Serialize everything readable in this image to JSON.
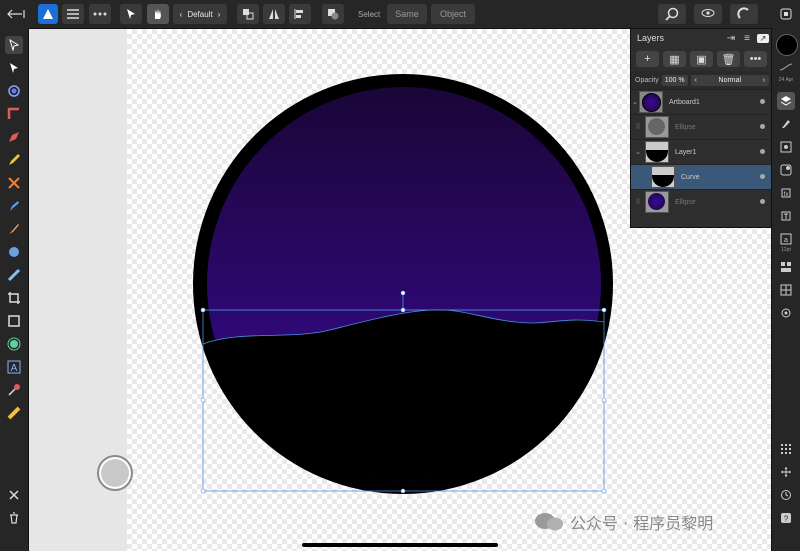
{
  "toolbar": {
    "persona_menu": "Default",
    "select_label": "Select",
    "select_same": "Same",
    "select_object": "Object"
  },
  "layers_panel": {
    "title": "Layers",
    "opacity_label": "Opacity",
    "opacity_value": "100 %",
    "blend_mode": "Normal",
    "layers": [
      {
        "name": "Artboard1",
        "selected": false,
        "dimmed": false
      },
      {
        "name": "Ellipse",
        "selected": false,
        "dimmed": true
      },
      {
        "name": "Layer1",
        "selected": false,
        "dimmed": false
      },
      {
        "name": "Curve",
        "selected": true,
        "dimmed": false
      },
      {
        "name": "Ellipse",
        "selected": false,
        "dimmed": true
      }
    ]
  },
  "right_toolbar": {
    "stroke_width_label": "24 Apr",
    "text_size_label": "12pt"
  },
  "watermark": "公众号 · 程序员黎明",
  "colors": {
    "sky_top": "#1a0638",
    "sky_bottom": "#3a0a9a",
    "ring": "#000000",
    "selection": "#4a90e2",
    "selected_layer": "#3c5878"
  }
}
